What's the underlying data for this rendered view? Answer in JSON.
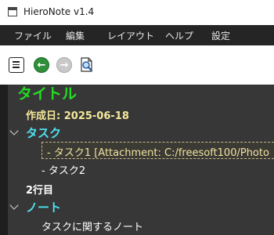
{
  "window": {
    "title": "HieroNote v1.4"
  },
  "menubar": {
    "items": [
      "ファイル",
      "編集",
      "レイアウト",
      "ヘルプ",
      "設定"
    ]
  },
  "toolbar": {
    "buttons": [
      {
        "name": "list-view",
        "icon": "list-icon"
      },
      {
        "name": "back",
        "icon": "arrow-left-icon",
        "color": "#2f8f3a"
      },
      {
        "name": "forward",
        "icon": "arrow-right-icon",
        "color": "#c9c9c9",
        "state": "disabled"
      },
      {
        "name": "find",
        "icon": "document-search-icon"
      }
    ]
  },
  "note": {
    "title": "タイトル",
    "created": "作成日: 2025-06-18",
    "sections": [
      {
        "heading": "タスク",
        "items": [
          "- タスク1 [Attachment: C:/freesoft100/Photo",
          "- タスク2"
        ]
      },
      {
        "line": "2行目"
      },
      {
        "heading": "ノート",
        "items": [
          "タスクに関するノート"
        ]
      }
    ]
  },
  "colors": {
    "title": "#22dd22",
    "heading": "#4fe0f0",
    "meta": "#f5e99a",
    "background": "#373737"
  }
}
